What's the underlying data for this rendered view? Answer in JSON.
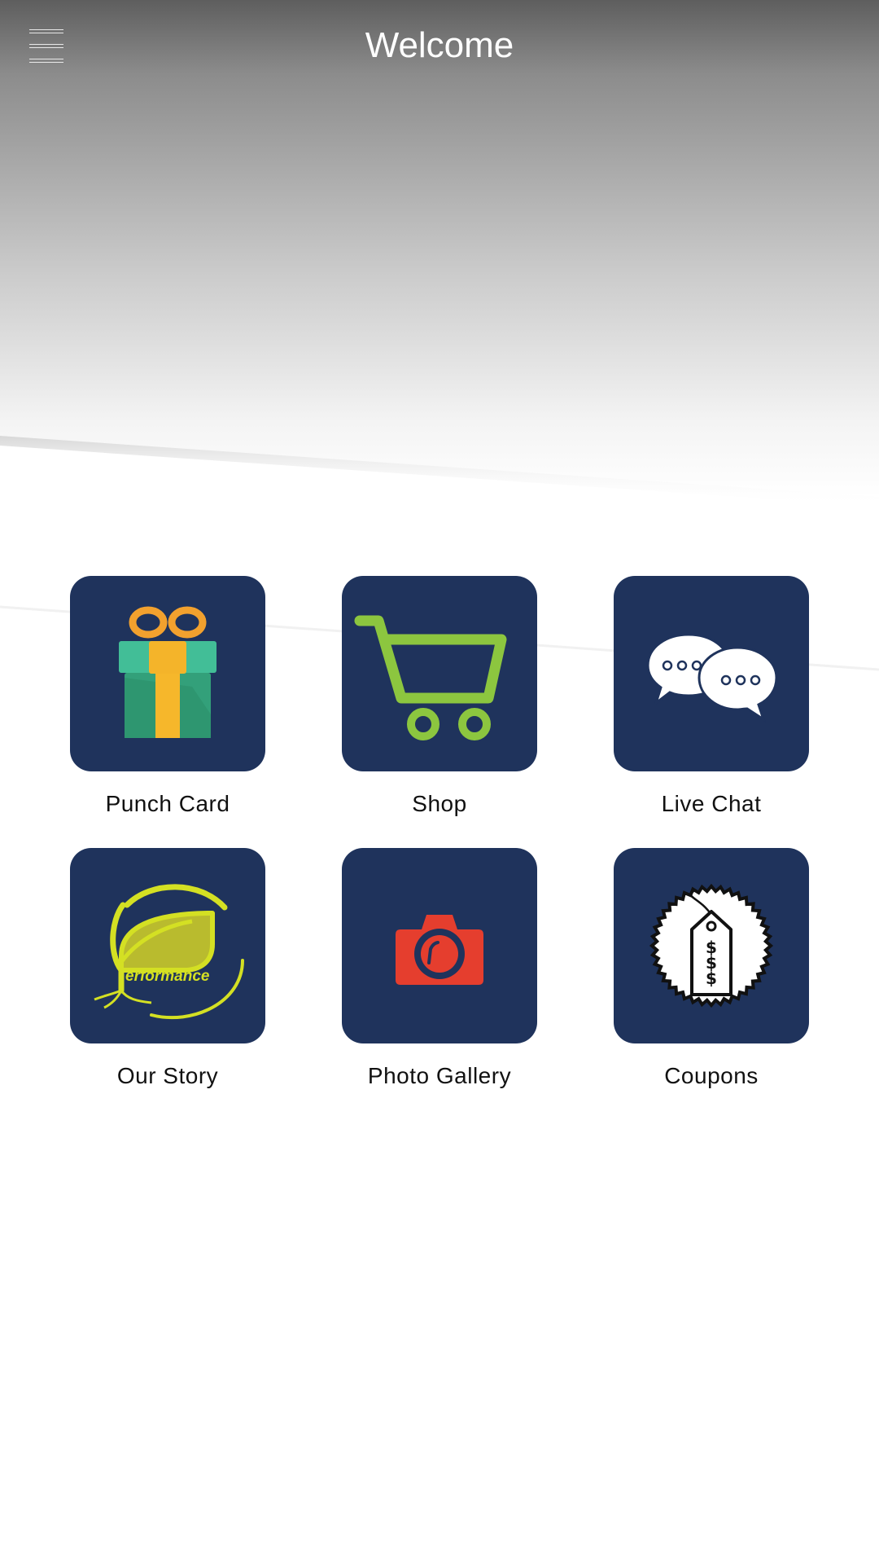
{
  "header": {
    "title": "Welcome",
    "menu_icon": "hamburger-menu-icon"
  },
  "tiles": [
    {
      "label": "Punch Card",
      "icon": "gift-icon"
    },
    {
      "label": "Shop",
      "icon": "shopping-cart-icon"
    },
    {
      "label": "Live Chat",
      "icon": "chat-bubbles-icon"
    },
    {
      "label": "Our Story",
      "icon": "performance-logo-icon",
      "logo_text": "erformance"
    },
    {
      "label": "Photo Gallery",
      "icon": "camera-icon"
    },
    {
      "label": "Coupons",
      "icon": "price-tag-icon"
    }
  ],
  "colors": {
    "tile_background": "#1f335c",
    "header_gradient_top": "#5e5e5e",
    "header_gradient_bottom": "#ffffff",
    "cart_green": "#8cc63f",
    "camera_red": "#e53e2e",
    "logo_yellow": "#d4e023"
  }
}
